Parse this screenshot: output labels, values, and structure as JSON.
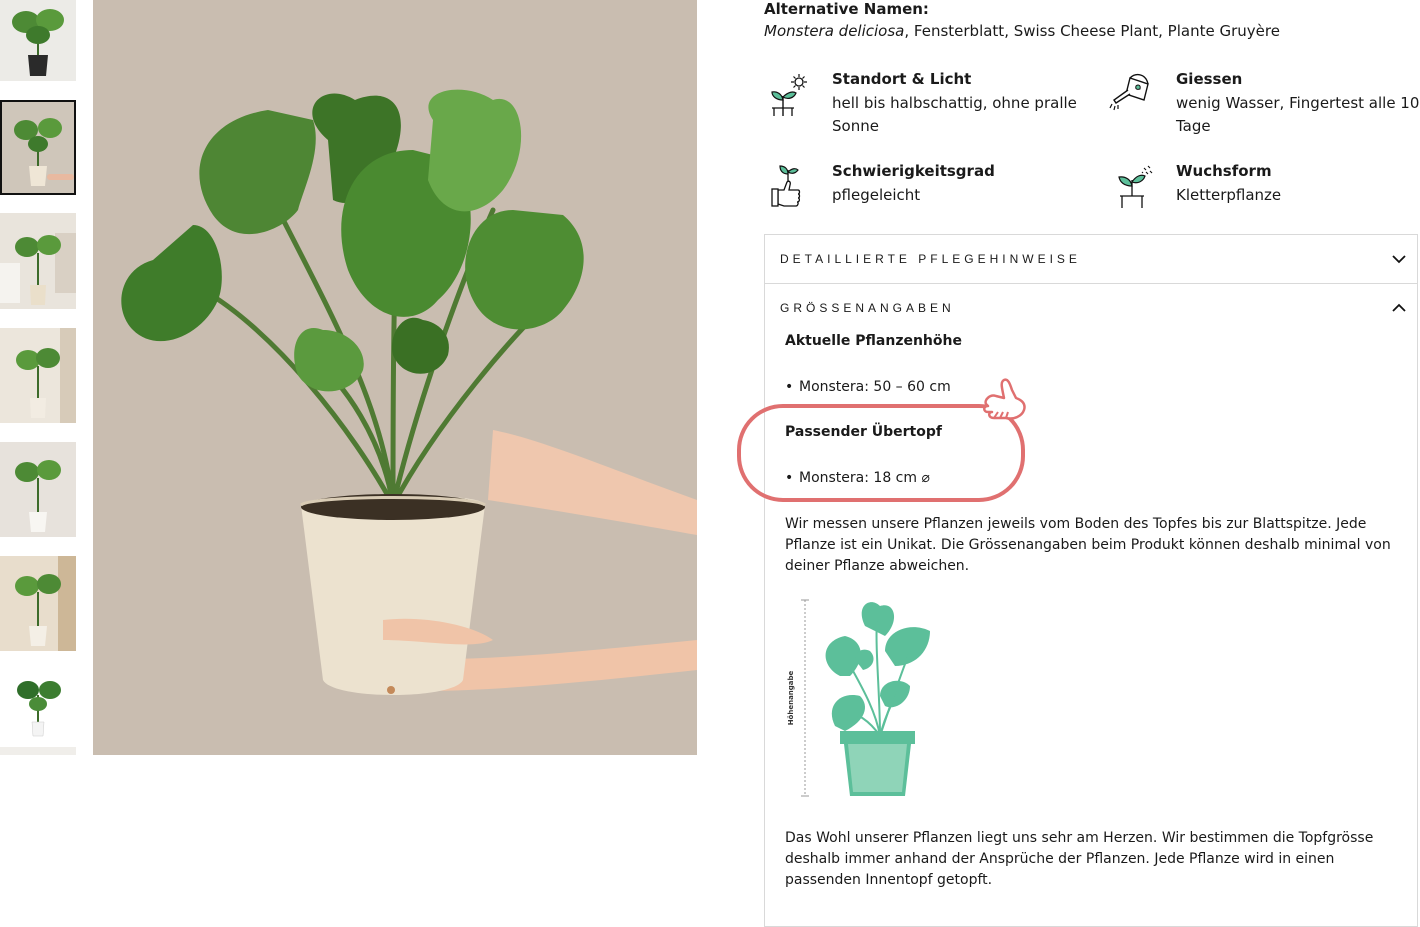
{
  "gallery": {
    "thumbnails": [
      "thumb-1",
      "thumb-2",
      "thumb-3",
      "thumb-4",
      "thumb-5",
      "thumb-6",
      "thumb-7"
    ],
    "selected_index": 1
  },
  "details": {
    "alt_names_title": "Alternative Namen:",
    "alt_names_italic": "Monstera deliciosa",
    "alt_names_rest": ", Fensterblatt, Swiss Cheese Plant, Plante Gruyère"
  },
  "features": [
    {
      "title": "Standort & Licht",
      "value": "hell bis halbschattig, ohne pralle Sonne",
      "icon": "sun-plant-icon"
    },
    {
      "title": "Giessen",
      "value": "wenig Wasser, Fingertest alle 10 Tage",
      "icon": "watering-can-icon"
    },
    {
      "title": "Schwierigkeitsgrad",
      "value": "pflegeleicht",
      "icon": "thumbs-up-plant-icon"
    },
    {
      "title": "Wuchsform",
      "value": "Kletterpflanze",
      "icon": "sprout-pot-icon"
    }
  ],
  "accordion": {
    "care_label": "DETAILLIERTE PFLEGEHINWEISE",
    "size_label": "GRÖSSENANGABEN",
    "height_heading": "Aktuelle Pflanzenhöhe",
    "height_item": "Monstera: 50 – 60 cm",
    "pot_heading": "Passender Übertopf",
    "pot_item": "Monstera: 18 cm ⌀",
    "measure_text": "Wir messen unsere Pflanzen jeweils vom Boden des Topfes bis zur Blattspitze. Jede Pflanze ist ein Unikat. Die Grössenangaben beim Produkt können deshalb minimal von deiner Pflanze abweichen.",
    "illustration_label": "Höhenangabe",
    "pot_text": "Das Wohl unserer Pflanzen liegt uns sehr am Herzen. Wir bestimmen die Topfgrösse deshalb immer anhand der Ansprüche der Pflanzen. Jede Pflanze wird in einen passenden Innentopf getopft."
  },
  "colors": {
    "accent_teal": "#5cbf9a",
    "highlight": "#e07070"
  }
}
